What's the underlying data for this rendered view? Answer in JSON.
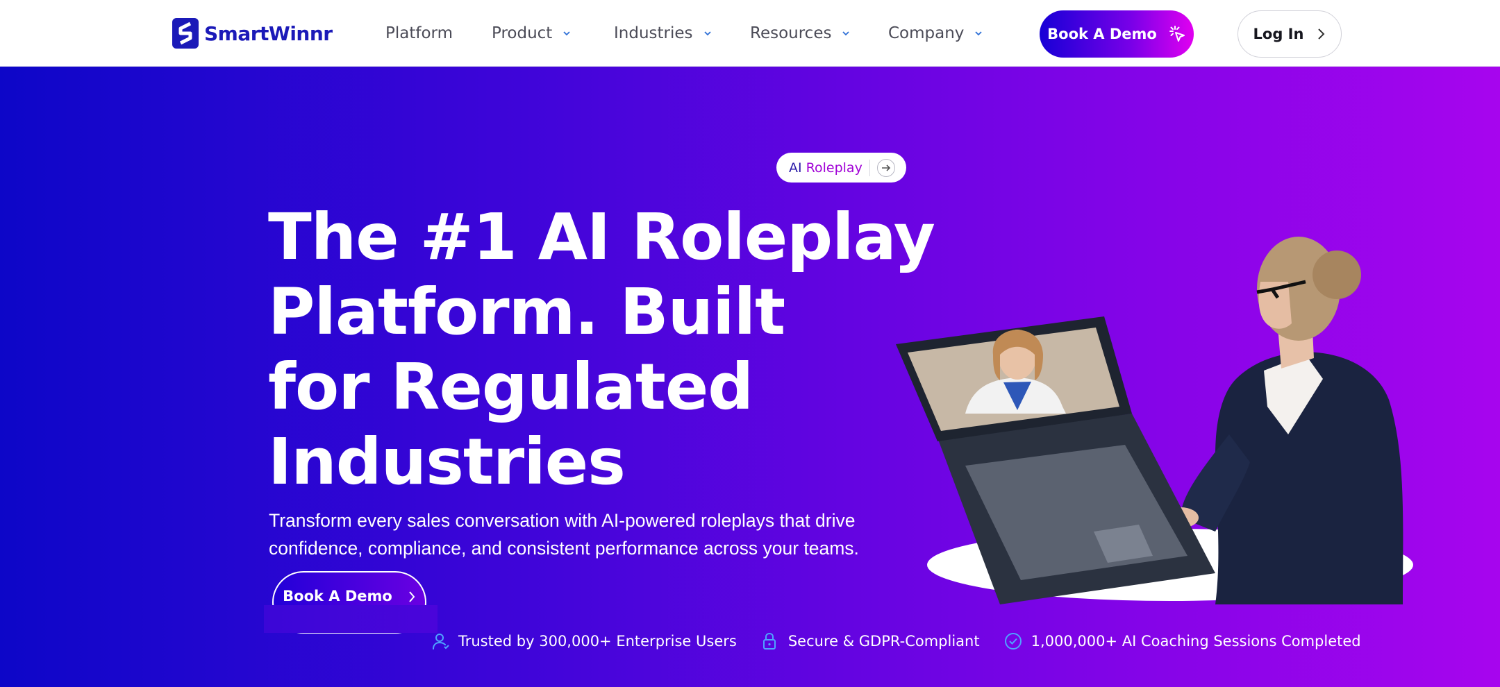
{
  "brand": {
    "name": "SmartWinnr",
    "color": "#1b1ab8"
  },
  "nav": {
    "items": [
      {
        "label": "Platform",
        "has_dropdown": false
      },
      {
        "label": "Product",
        "has_dropdown": true
      },
      {
        "label": "Industries",
        "has_dropdown": true
      },
      {
        "label": "Resources",
        "has_dropdown": true
      },
      {
        "label": "Company",
        "has_dropdown": true
      }
    ],
    "demo_label": "Book A Demo",
    "login_label": "Log In"
  },
  "hero": {
    "pill": {
      "part1": "AI ",
      "part2": "Roleplay"
    },
    "headline_lines": [
      "The #1 AI Roleplay",
      "Platform. Built",
      "for Regulated",
      "Industries"
    ],
    "subtitle_lines": [
      "Transform every sales conversation with AI-powered roleplays that drive",
      "confidence, compliance, and consistent performance across your teams."
    ],
    "cta_label": "Book A Demo",
    "trust": [
      {
        "icon": "user-icon",
        "text": "Trusted by 300,000+ Enterprise Users"
      },
      {
        "icon": "lock-icon",
        "text": "Secure & GDPR-Compliant"
      },
      {
        "icon": "check-circle-icon",
        "text": "1,000,000+ AI Coaching Sessions Completed"
      }
    ],
    "illustration": "woman-at-laptop-video-call-with-doctor"
  },
  "colors": {
    "accent_start": "#1700d6",
    "accent_end": "#e100f0",
    "hero_bg_start": "#0d06c8",
    "hero_bg_end": "#a705ee"
  }
}
